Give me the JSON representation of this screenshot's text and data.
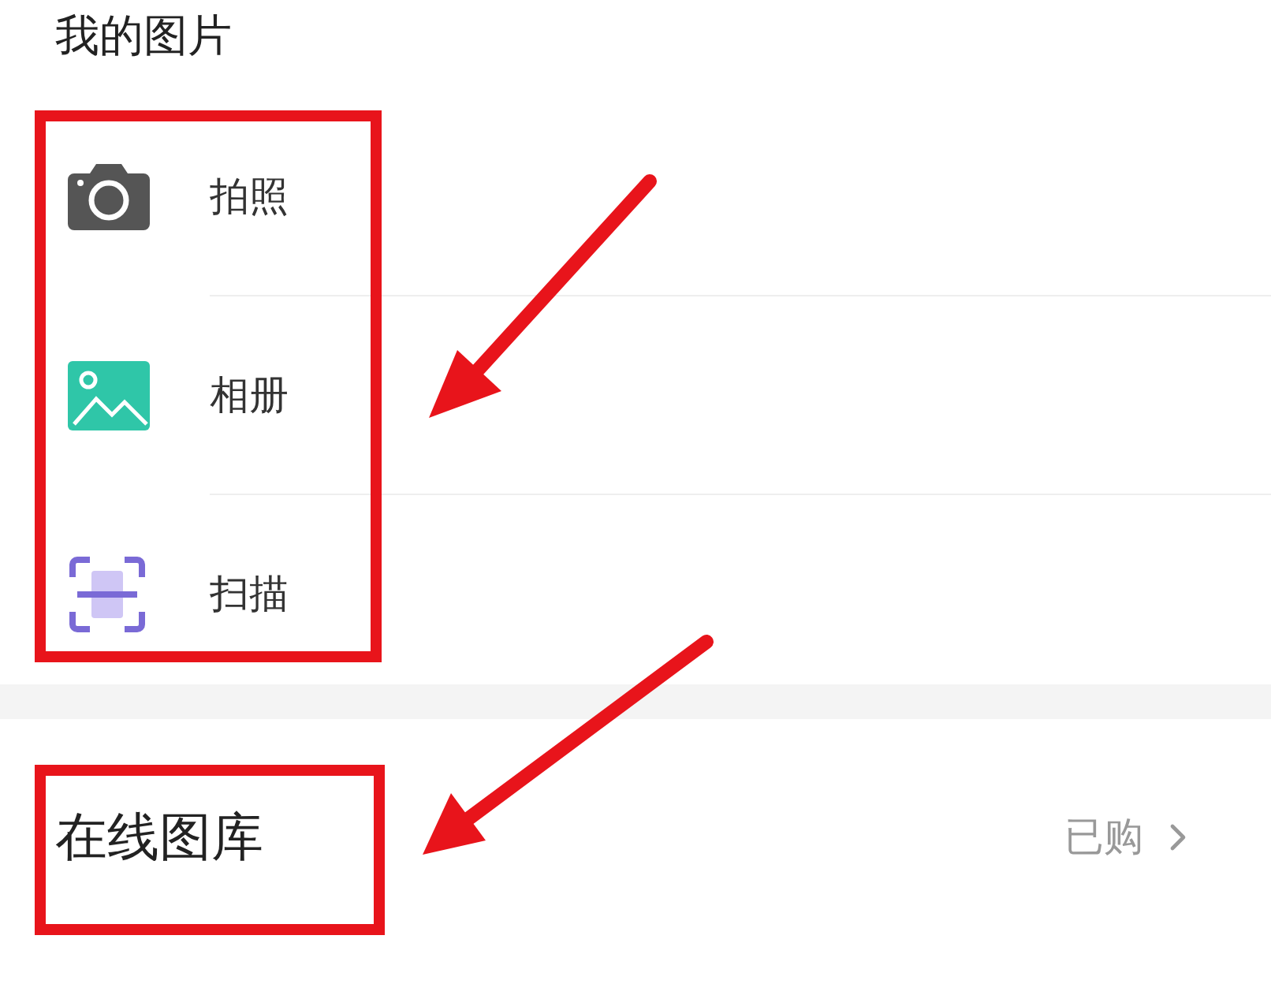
{
  "section_title": "我的图片",
  "items": [
    {
      "kind": "camera",
      "label": "拍照"
    },
    {
      "kind": "album",
      "label": "相册"
    },
    {
      "kind": "scan",
      "label": "扫描"
    }
  ],
  "online_gallery": {
    "title": "在线图库",
    "status": "已购"
  }
}
